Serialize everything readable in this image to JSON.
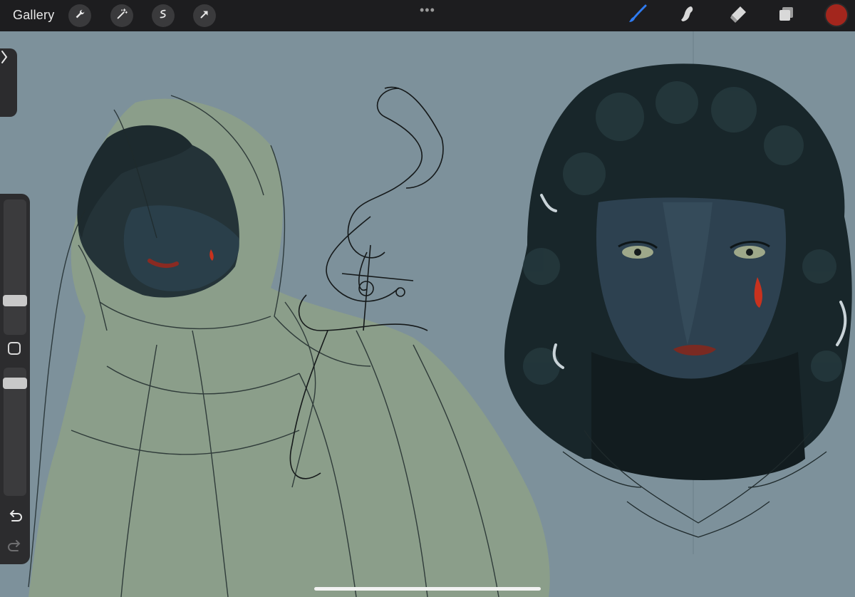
{
  "topbar": {
    "gallery_label": "Gallery",
    "more_label": "•••",
    "left_tools": [
      "wrench-icon",
      "magic-wand-icon",
      "selection-icon",
      "transform-arrow-icon"
    ],
    "right_tools": [
      "brush-icon",
      "smudge-icon",
      "eraser-icon",
      "layers-icon"
    ],
    "active_tool": "brush-icon",
    "brush_color": "#2f7bf0",
    "current_color": "#a3261d"
  },
  "sidebar": {
    "brush_size_level": 0.26,
    "opacity_level": 0.62
  },
  "canvas": {
    "background": "#7d919b"
  }
}
